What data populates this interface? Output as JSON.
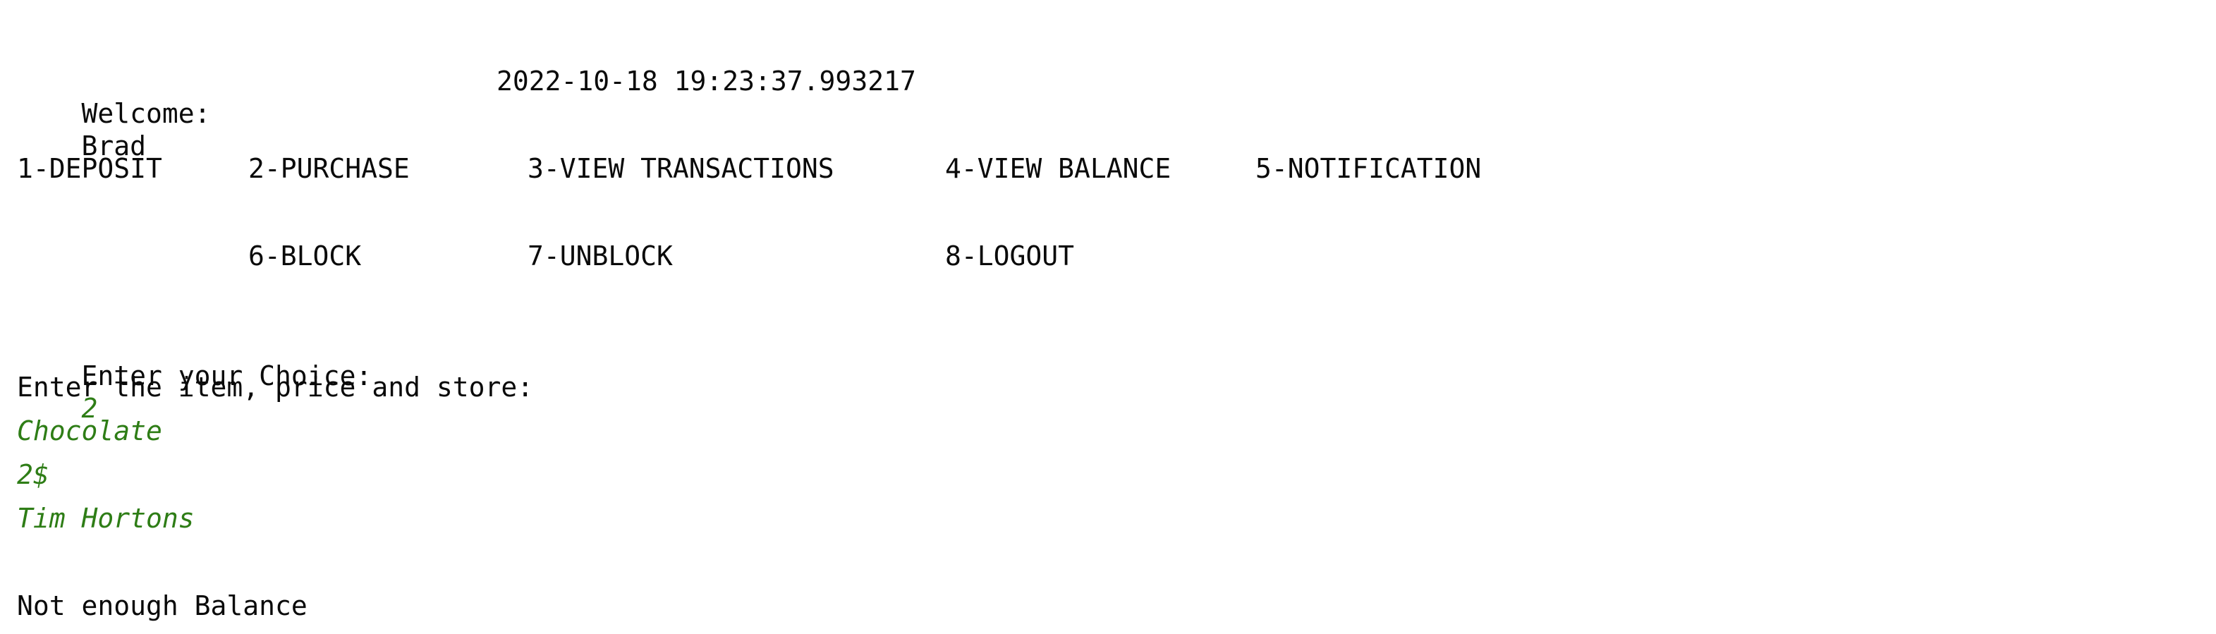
{
  "header": {
    "welcome_label": "Welcome:",
    "user_name": "Brad",
    "timestamp": "2022-10-18 19:23:37.993217"
  },
  "menu": {
    "row1": [
      "1-DEPOSIT",
      "2-PURCHASE",
      "3-VIEW TRANSACTIONS",
      "4-VIEW BALANCE",
      "5-NOTIFICATION"
    ],
    "row2": [
      "6-BLOCK",
      "7-UNBLOCK",
      "8-LOGOUT"
    ]
  },
  "prompt": {
    "choice_label": "Enter your Choice:",
    "choice_value": "2",
    "item_prompt": "Enter the item, price and store:",
    "item_value": "Chocolate",
    "price_value": "2$",
    "store_value": "Tim Hortons"
  },
  "result": {
    "message": "Not enough Balance"
  },
  "colors": {
    "text": "#0a0a0a",
    "user_input": "#2e7d16",
    "background": "#ffffff"
  }
}
